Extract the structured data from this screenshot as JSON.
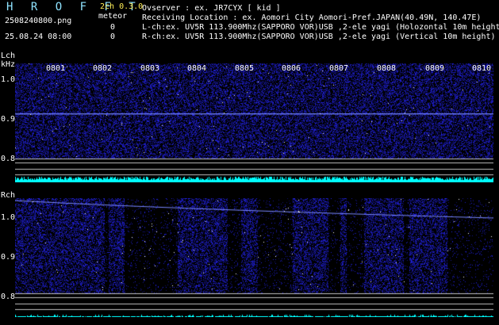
{
  "header": {
    "brand": "H R O F F T",
    "filename": "2508240800.png",
    "datetime": "25.08.24 08:00",
    "mode": "2ch 0.3.0",
    "meteor_label": "meteor",
    "count_l": "0",
    "count_r": "0"
  },
  "info": {
    "observer": "Ovserver           : ex. JR7CYX [ kid ]",
    "location": "Receiving Location : ex. Aomori City Aomori-Pref.JAPAN(40.49N, 140.47E)",
    "lch": "L-ch:ex. UV5R 113.900Mhz(SAPPORO VOR)USB ,2-ele yagi (Holozontal 10m height)",
    "rch": "R-ch:ex. UV5R 113.900Mhz(SAPPORO VOR)USB ,2-ele yagi (Vertical 10m height)"
  },
  "lch": {
    "label": "Lch",
    "unit": "kHz",
    "ticks": [
      "1.0",
      "0.9",
      "0.8"
    ]
  },
  "rch": {
    "label": "Rch",
    "ticks": [
      "1.0",
      "0.9",
      "0.8"
    ]
  },
  "time_labels": [
    "0801",
    "0802",
    "0803",
    "0804",
    "0805",
    "0806",
    "0807",
    "0808",
    "0809",
    "0810"
  ],
  "colors": {
    "brand": "#8fe3ff",
    "mode": "#ffee55",
    "noise": "#1e1e9a",
    "meteor_trace": "#00ffff",
    "grid": "#c0c0c0"
  }
}
